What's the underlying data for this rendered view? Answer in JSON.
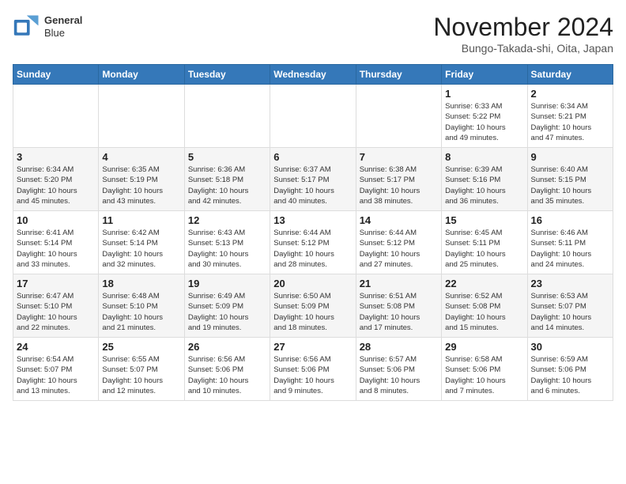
{
  "header": {
    "logo": {
      "line1": "General",
      "line2": "Blue"
    },
    "title": "November 2024",
    "subtitle": "Bungo-Takada-shi, Oita, Japan"
  },
  "weekdays": [
    "Sunday",
    "Monday",
    "Tuesday",
    "Wednesday",
    "Thursday",
    "Friday",
    "Saturday"
  ],
  "weeks": [
    [
      {
        "day": "",
        "info": ""
      },
      {
        "day": "",
        "info": ""
      },
      {
        "day": "",
        "info": ""
      },
      {
        "day": "",
        "info": ""
      },
      {
        "day": "",
        "info": ""
      },
      {
        "day": "1",
        "info": "Sunrise: 6:33 AM\nSunset: 5:22 PM\nDaylight: 10 hours\nand 49 minutes."
      },
      {
        "day": "2",
        "info": "Sunrise: 6:34 AM\nSunset: 5:21 PM\nDaylight: 10 hours\nand 47 minutes."
      }
    ],
    [
      {
        "day": "3",
        "info": "Sunrise: 6:34 AM\nSunset: 5:20 PM\nDaylight: 10 hours\nand 45 minutes."
      },
      {
        "day": "4",
        "info": "Sunrise: 6:35 AM\nSunset: 5:19 PM\nDaylight: 10 hours\nand 43 minutes."
      },
      {
        "day": "5",
        "info": "Sunrise: 6:36 AM\nSunset: 5:18 PM\nDaylight: 10 hours\nand 42 minutes."
      },
      {
        "day": "6",
        "info": "Sunrise: 6:37 AM\nSunset: 5:17 PM\nDaylight: 10 hours\nand 40 minutes."
      },
      {
        "day": "7",
        "info": "Sunrise: 6:38 AM\nSunset: 5:17 PM\nDaylight: 10 hours\nand 38 minutes."
      },
      {
        "day": "8",
        "info": "Sunrise: 6:39 AM\nSunset: 5:16 PM\nDaylight: 10 hours\nand 36 minutes."
      },
      {
        "day": "9",
        "info": "Sunrise: 6:40 AM\nSunset: 5:15 PM\nDaylight: 10 hours\nand 35 minutes."
      }
    ],
    [
      {
        "day": "10",
        "info": "Sunrise: 6:41 AM\nSunset: 5:14 PM\nDaylight: 10 hours\nand 33 minutes."
      },
      {
        "day": "11",
        "info": "Sunrise: 6:42 AM\nSunset: 5:14 PM\nDaylight: 10 hours\nand 32 minutes."
      },
      {
        "day": "12",
        "info": "Sunrise: 6:43 AM\nSunset: 5:13 PM\nDaylight: 10 hours\nand 30 minutes."
      },
      {
        "day": "13",
        "info": "Sunrise: 6:44 AM\nSunset: 5:12 PM\nDaylight: 10 hours\nand 28 minutes."
      },
      {
        "day": "14",
        "info": "Sunrise: 6:44 AM\nSunset: 5:12 PM\nDaylight: 10 hours\nand 27 minutes."
      },
      {
        "day": "15",
        "info": "Sunrise: 6:45 AM\nSunset: 5:11 PM\nDaylight: 10 hours\nand 25 minutes."
      },
      {
        "day": "16",
        "info": "Sunrise: 6:46 AM\nSunset: 5:11 PM\nDaylight: 10 hours\nand 24 minutes."
      }
    ],
    [
      {
        "day": "17",
        "info": "Sunrise: 6:47 AM\nSunset: 5:10 PM\nDaylight: 10 hours\nand 22 minutes."
      },
      {
        "day": "18",
        "info": "Sunrise: 6:48 AM\nSunset: 5:10 PM\nDaylight: 10 hours\nand 21 minutes."
      },
      {
        "day": "19",
        "info": "Sunrise: 6:49 AM\nSunset: 5:09 PM\nDaylight: 10 hours\nand 19 minutes."
      },
      {
        "day": "20",
        "info": "Sunrise: 6:50 AM\nSunset: 5:09 PM\nDaylight: 10 hours\nand 18 minutes."
      },
      {
        "day": "21",
        "info": "Sunrise: 6:51 AM\nSunset: 5:08 PM\nDaylight: 10 hours\nand 17 minutes."
      },
      {
        "day": "22",
        "info": "Sunrise: 6:52 AM\nSunset: 5:08 PM\nDaylight: 10 hours\nand 15 minutes."
      },
      {
        "day": "23",
        "info": "Sunrise: 6:53 AM\nSunset: 5:07 PM\nDaylight: 10 hours\nand 14 minutes."
      }
    ],
    [
      {
        "day": "24",
        "info": "Sunrise: 6:54 AM\nSunset: 5:07 PM\nDaylight: 10 hours\nand 13 minutes."
      },
      {
        "day": "25",
        "info": "Sunrise: 6:55 AM\nSunset: 5:07 PM\nDaylight: 10 hours\nand 12 minutes."
      },
      {
        "day": "26",
        "info": "Sunrise: 6:56 AM\nSunset: 5:06 PM\nDaylight: 10 hours\nand 10 minutes."
      },
      {
        "day": "27",
        "info": "Sunrise: 6:56 AM\nSunset: 5:06 PM\nDaylight: 10 hours\nand 9 minutes."
      },
      {
        "day": "28",
        "info": "Sunrise: 6:57 AM\nSunset: 5:06 PM\nDaylight: 10 hours\nand 8 minutes."
      },
      {
        "day": "29",
        "info": "Sunrise: 6:58 AM\nSunset: 5:06 PM\nDaylight: 10 hours\nand 7 minutes."
      },
      {
        "day": "30",
        "info": "Sunrise: 6:59 AM\nSunset: 5:06 PM\nDaylight: 10 hours\nand 6 minutes."
      }
    ]
  ]
}
